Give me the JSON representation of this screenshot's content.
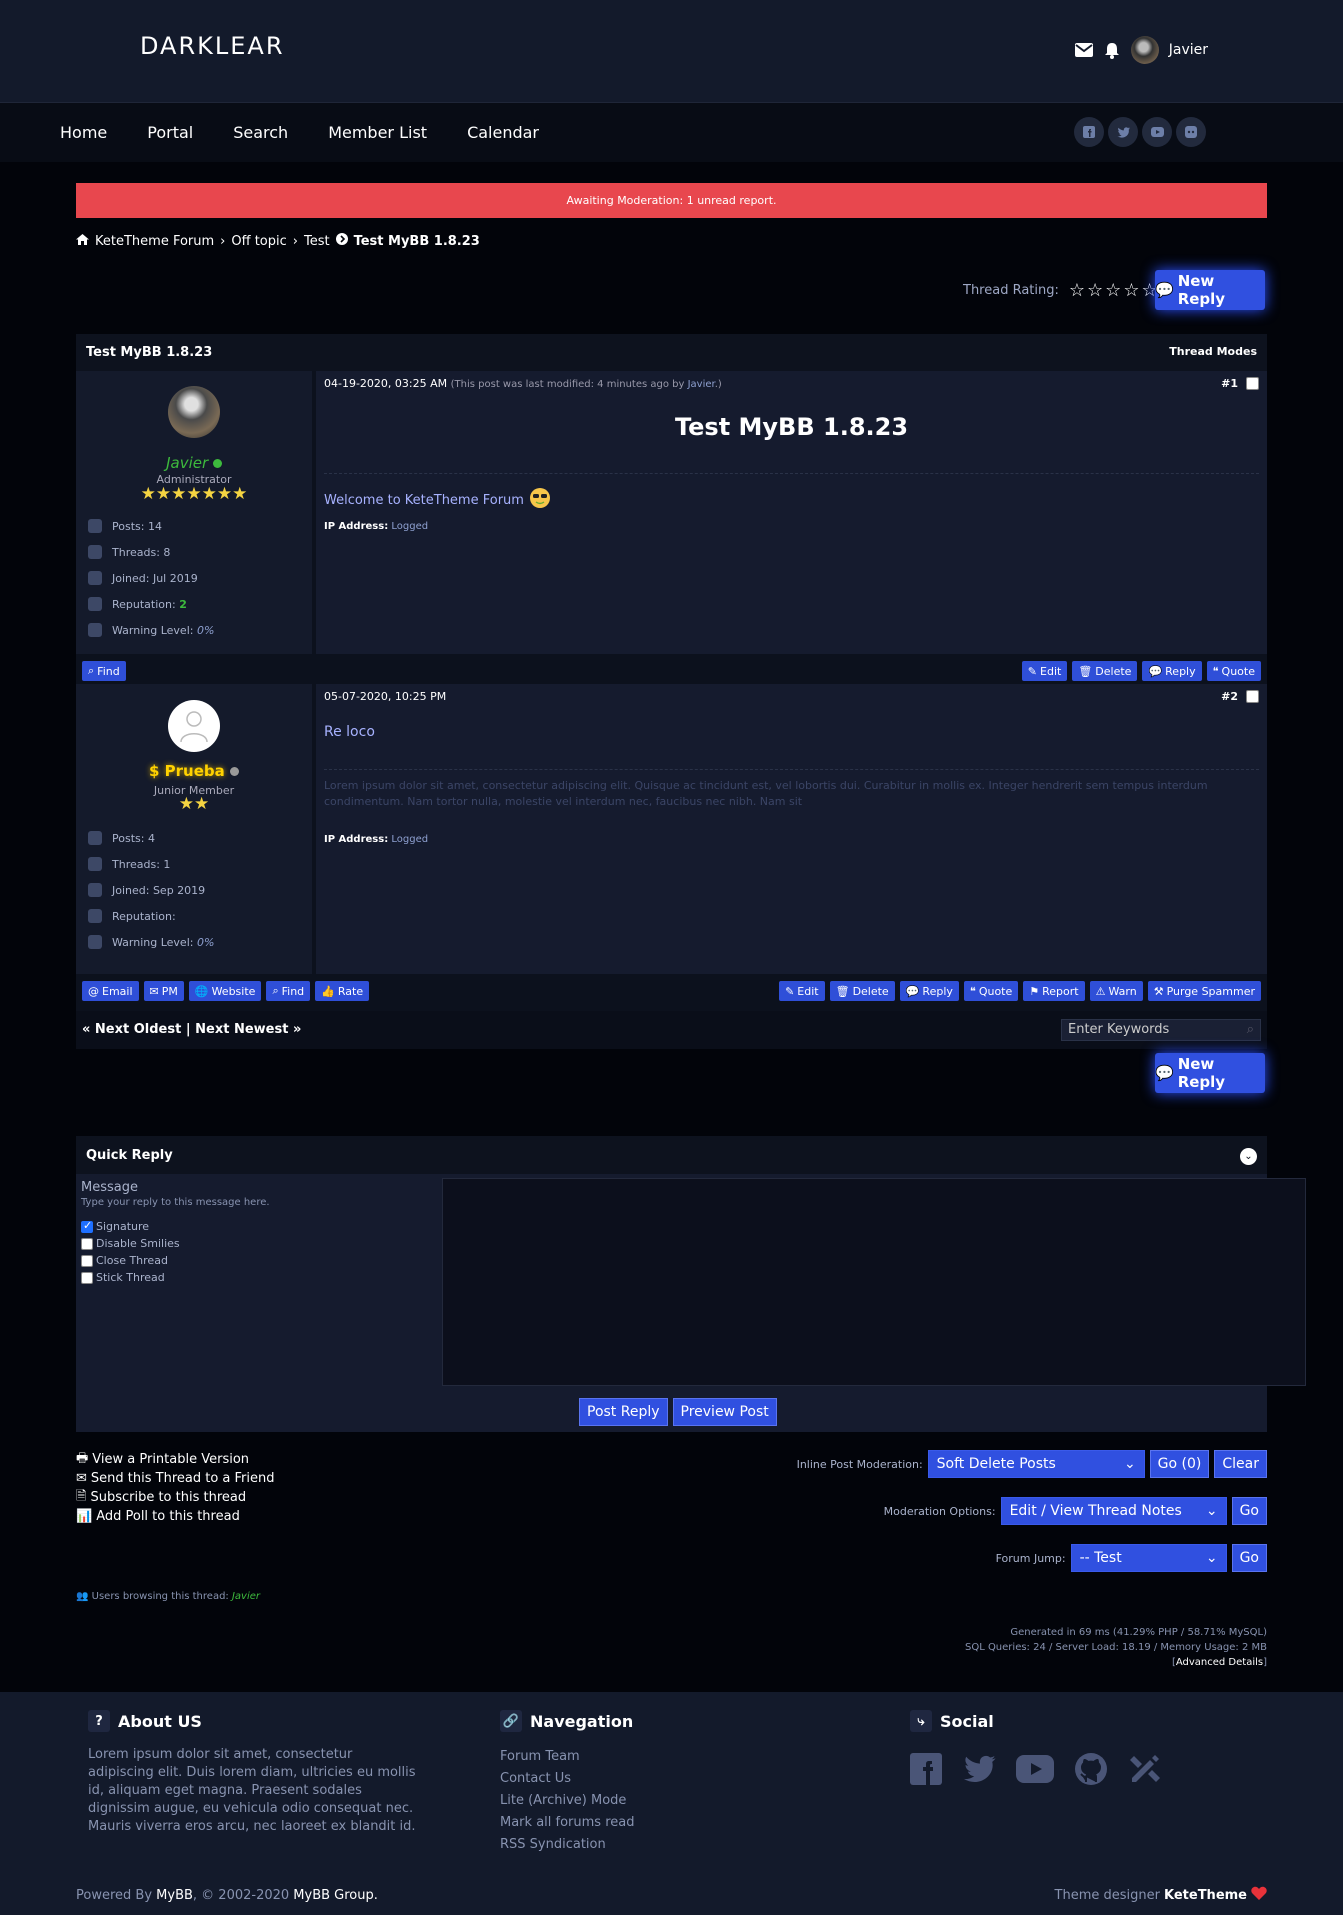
{
  "header": {
    "logo": "DARKLEAR",
    "username": "Javier"
  },
  "nav": {
    "items": [
      "Home",
      "Portal",
      "Search",
      "Member List",
      "Calendar"
    ]
  },
  "alert": "Awaiting Moderation: 1 unread report.",
  "breadcrumb": {
    "items": [
      "KeteTheme Forum",
      "Off topic",
      "Test"
    ],
    "current": "Test MyBB 1.8.23"
  },
  "rating": {
    "label": "Thread Rating:",
    "stars": 0
  },
  "new_reply_label": "New Reply",
  "thread": {
    "title": "Test MyBB 1.8.23",
    "modes_label": "Thread Modes"
  },
  "posts": [
    {
      "date": "04-19-2020, 03:25 AM",
      "modified_prefix": "(This post was last modified: 4 minutes ago by ",
      "modified_by": "Javier",
      "modified_suffix": ".)",
      "number": "#1",
      "author": "Javier",
      "role": "Administrator",
      "stars": "★★★★★★★",
      "posts": "Posts: 14",
      "threads": "Threads: 8",
      "joined": "Joined: Jul 2019",
      "reputation_label": "Reputation: ",
      "reputation_value": "2",
      "warning_label": "Warning Level: ",
      "warning_value": "0%",
      "title": "Test MyBB 1.8.23",
      "message": "Welcome to KeteTheme Forum",
      "ip_label": "IP Address:",
      "ip_value": "Logged",
      "left_buttons": [
        "Find"
      ],
      "right_buttons": [
        "Edit",
        "Delete",
        "Reply",
        "Quote"
      ]
    },
    {
      "date": "05-07-2020, 10:25 PM",
      "number": "#2",
      "author": "$ Prueba",
      "role": "Junior Member",
      "stars": "★★",
      "posts": "Posts: 4",
      "threads": "Threads: 1",
      "joined": "Joined: Sep 2019",
      "reputation_label": "Reputation:",
      "warning_label": "Warning Level: ",
      "warning_value": "0%",
      "message": "Re loco",
      "signature": "Lorem ipsum dolor sit amet, consectetur adipiscing elit. Quisque ac tincidunt est, vel lobortis dui. Curabitur in mollis ex. Integer hendrerit sem tempus interdum condimentum. Nam tortor nulla, molestie vel interdum nec, faucibus nec nibh. Nam sit",
      "ip_label": "IP Address:",
      "ip_value": "Logged",
      "left_buttons": [
        "Email",
        "PM",
        "Website",
        "Find",
        "Rate"
      ],
      "right_buttons": [
        "Edit",
        "Delete",
        "Reply",
        "Quote",
        "Report",
        "Warn",
        "Purge Spammer"
      ]
    }
  ],
  "pager": {
    "text": "« Next Oldest | Next Newest »",
    "search_placeholder": "Enter Keywords"
  },
  "quick_reply": {
    "title": "Quick Reply",
    "message_label": "Message",
    "message_hint": "Type your reply to this message here.",
    "options": [
      {
        "label": "Signature",
        "checked": true
      },
      {
        "label": "Disable Smilies",
        "checked": false
      },
      {
        "label": "Close Thread",
        "checked": false
      },
      {
        "label": "Stick Thread",
        "checked": false
      }
    ],
    "post_reply": "Post Reply",
    "preview_post": "Preview Post"
  },
  "tools": [
    "View a Printable Version",
    "Send this Thread to a Friend",
    "Subscribe to this thread",
    "Add Poll to this thread"
  ],
  "moderation": {
    "inline_label": "Inline Post Moderation:",
    "inline_value": "Soft Delete Posts",
    "inline_go": "Go (0)",
    "clear": "Clear",
    "options_label": "Moderation Options:",
    "options_value": "Edit / View Thread Notes",
    "go": "Go",
    "jump_label": "Forum Jump:",
    "jump_value": "-- Test"
  },
  "browsing": {
    "label": "Users browsing this thread: ",
    "user": "Javier"
  },
  "debug": {
    "line1": "Generated in 69 ms (41.29% PHP / 58.71% MySQL)",
    "line2": "SQL Queries: 24 / Server Load: 18.19 / Memory Usage: 2 MB",
    "advanced": "Advanced Details"
  },
  "footer": {
    "about_title": "About US",
    "about_text": "Lorem ipsum dolor sit amet, consectetur adipiscing elit. Duis lorem diam, ultricies eu mollis id, aliquam eget magna. Praesent sodales dignissim augue, eu vehicula odio consequat nec. Mauris viverra eros arcu, nec laoreet ex blandit id.",
    "nav_title": "Navegation",
    "nav_links": [
      "Forum Team",
      "Contact Us",
      "Lite (Archive) Mode",
      "Mark all forums read",
      "RSS Syndication"
    ],
    "social_title": "Social",
    "powered_prefix": "Powered By ",
    "powered_mybb": "MyBB",
    "powered_mid": ", © 2002-2020 ",
    "powered_group": "MyBB Group.",
    "designer_label": "Theme designer ",
    "designer_name": "KeteTheme"
  },
  "colors": {
    "accent": "#3050e0",
    "alert": "#e8474e",
    "online": "#3dba3d",
    "gold": "#f5d442"
  }
}
